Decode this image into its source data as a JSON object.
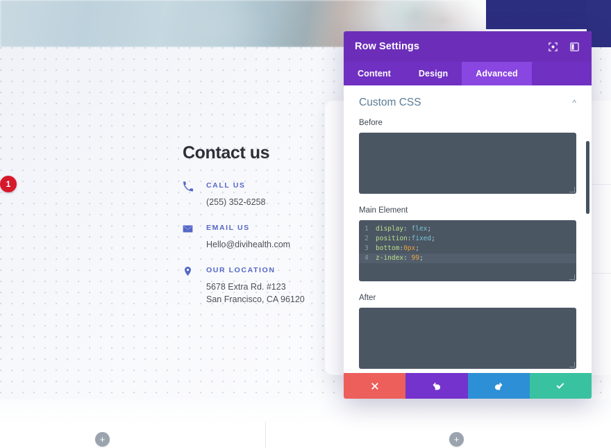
{
  "website": {
    "contact": {
      "heading": "Contact us",
      "items": [
        {
          "icon": "phone-icon",
          "label": "CALL US",
          "lines": [
            "(255) 352-6258"
          ]
        },
        {
          "icon": "envelope-icon",
          "label": "EMAIL US",
          "lines": [
            "Hello@divihealth.com"
          ]
        },
        {
          "icon": "map-pin-icon",
          "label": "OUR LOCATION",
          "lines": [
            "5678 Extra Rd. #123",
            "San Francisco, CA 96120"
          ]
        }
      ]
    },
    "add_buttons": {
      "label": "+"
    }
  },
  "modal": {
    "title": "Row Settings",
    "header_icons": [
      {
        "name": "fullscreen-icon",
        "title": "Expand"
      },
      {
        "name": "layout-view-icon",
        "title": "Change Layout"
      }
    ],
    "tabs": [
      {
        "label": "Content",
        "active": false
      },
      {
        "label": "Design",
        "active": false
      },
      {
        "label": "Advanced",
        "active": true
      }
    ],
    "section": {
      "title": "Custom CSS",
      "collapse_icon": "chevron-up-icon"
    },
    "fields": [
      {
        "label": "Before",
        "value": ""
      },
      {
        "label": "Main Element",
        "value": "display: flex;\nposition:fixed;\nbottom:0px;\nz-index: 99;"
      },
      {
        "label": "After",
        "value": ""
      }
    ],
    "main_element_code": [
      {
        "num": "1",
        "prop": "display",
        "sep": ": ",
        "val": "flex",
        "end": ";",
        "highlight": false
      },
      {
        "num": "2",
        "prop": "position",
        "sep": ":",
        "val": "fixed",
        "end": ";",
        "highlight": false
      },
      {
        "num": "3",
        "prop": "bottom",
        "sep": ":",
        "val": "0px",
        "end": ";",
        "highlight": false,
        "numeric": true
      },
      {
        "num": "4",
        "prop": "z-index",
        "sep": ": ",
        "val": "99",
        "end": ";",
        "highlight": true,
        "numeric": true
      }
    ],
    "annotation_badge": "1",
    "footer_buttons": [
      {
        "name": "cancel-button",
        "icon": "x-icon",
        "color": "#ec5f5a"
      },
      {
        "name": "undo-button",
        "icon": "undo-icon",
        "color": "#7433cd"
      },
      {
        "name": "redo-button",
        "icon": "redo-icon",
        "color": "#2d8fd5"
      },
      {
        "name": "save-button",
        "icon": "check-icon",
        "color": "#39c2a0"
      }
    ]
  },
  "colors": {
    "modal_header": "#6c2eb9",
    "tab_bar": "#7030c2",
    "tab_active": "#8a46e0",
    "code_bg": "#4b5663",
    "accent_blue": "#5568c8",
    "badge_red": "#d6182b"
  }
}
